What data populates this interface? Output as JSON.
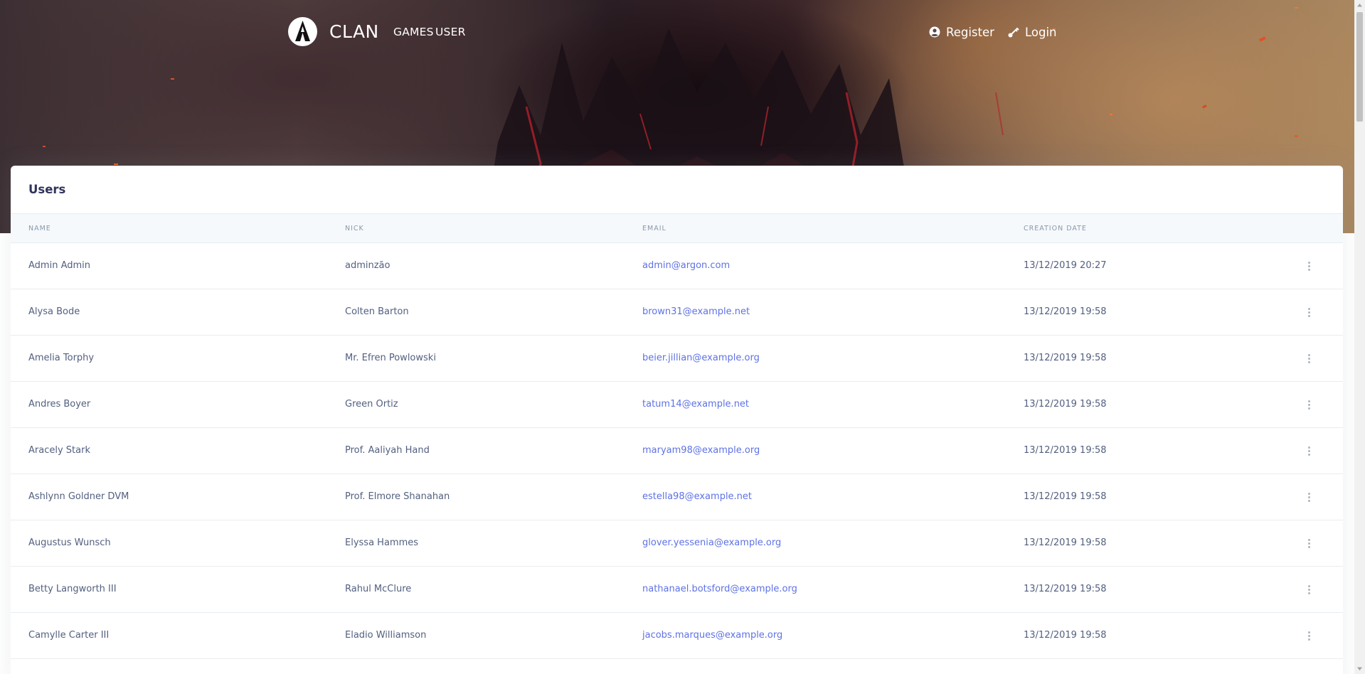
{
  "brand": {
    "name": "CLAN",
    "logo_icon": "assassin-emblem-icon"
  },
  "nav": {
    "games_label": "GAMES",
    "user_label": "USER",
    "register_label": "Register",
    "login_label": "Login",
    "register_icon": "user-circle-icon",
    "login_icon": "key-icon"
  },
  "card": {
    "title": "Users",
    "columns": {
      "name": "NAME",
      "nick": "NICK",
      "email": "EMAIL",
      "created": "CREATION DATE"
    },
    "rows": [
      {
        "name": "Admin Admin",
        "nick": "adminzão",
        "email": "admin@argon.com",
        "created": "13/12/2019 20:27"
      },
      {
        "name": "Alysa Bode",
        "nick": "Colten Barton",
        "email": "brown31@example.net",
        "created": "13/12/2019 19:58"
      },
      {
        "name": "Amelia Torphy",
        "nick": "Mr. Efren Powlowski",
        "email": "beier.jillian@example.org",
        "created": "13/12/2019 19:58"
      },
      {
        "name": "Andres Boyer",
        "nick": "Green Ortiz",
        "email": "tatum14@example.net",
        "created": "13/12/2019 19:58"
      },
      {
        "name": "Aracely Stark",
        "nick": "Prof. Aaliyah Hand",
        "email": "maryam98@example.org",
        "created": "13/12/2019 19:58"
      },
      {
        "name": "Ashlynn Goldner DVM",
        "nick": "Prof. Elmore Shanahan",
        "email": "estella98@example.net",
        "created": "13/12/2019 19:58"
      },
      {
        "name": "Augustus Wunsch",
        "nick": "Elyssa Hammes",
        "email": "glover.yessenia@example.org",
        "created": "13/12/2019 19:58"
      },
      {
        "name": "Betty Langworth III",
        "nick": "Rahul McClure",
        "email": "nathanael.botsford@example.org",
        "created": "13/12/2019 19:58"
      },
      {
        "name": "Camylle Carter III",
        "nick": "Eladio Williamson",
        "email": "jacobs.marques@example.org",
        "created": "13/12/2019 19:58"
      }
    ]
  },
  "colors": {
    "accent": "#5e72e4",
    "heading": "#32325d",
    "text": "#525f7f",
    "muted": "#8898aa"
  }
}
